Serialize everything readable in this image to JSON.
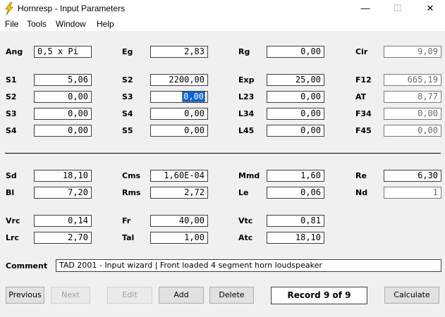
{
  "window": {
    "title": "Hornresp - Input Parameters",
    "min": "—",
    "max": "☐",
    "close": "✕"
  },
  "menu": [
    "File",
    "Tools",
    "Window",
    "Help"
  ],
  "rows": {
    "ang": {
      "label": "Ang",
      "value": "0,5 x Pi"
    },
    "eg": {
      "label": "Eg",
      "value": "2,83"
    },
    "rg": {
      "label": "Rg",
      "value": "0,00"
    },
    "cir": {
      "label": "Cir",
      "value": "9,09"
    },
    "s1": {
      "label": "S1",
      "value": "5,06"
    },
    "s2a": {
      "label": "S2",
      "value": "2200,00"
    },
    "exp": {
      "label": "Exp",
      "value": "25,00"
    },
    "f12": {
      "label": "F12",
      "value": "665,19"
    },
    "s2b": {
      "label": "S2",
      "value": "0,00"
    },
    "s3a": {
      "label": "S3",
      "value": "0,00"
    },
    "l23": {
      "label": "L23",
      "value": "0,00"
    },
    "at": {
      "label": "AT",
      "value": "8,77"
    },
    "s3b": {
      "label": "S3",
      "value": "0,00"
    },
    "s4a": {
      "label": "S4",
      "value": "0,00"
    },
    "l34": {
      "label": "L34",
      "value": "0,00"
    },
    "f34": {
      "label": "F34",
      "value": "0,00"
    },
    "s4b": {
      "label": "S4",
      "value": "0,00"
    },
    "s5": {
      "label": "S5",
      "value": "0,00"
    },
    "l45": {
      "label": "L45",
      "value": "0,00"
    },
    "f45": {
      "label": "F45",
      "value": "0,00"
    },
    "sd": {
      "label": "Sd",
      "value": "18,10"
    },
    "cms": {
      "label": "Cms",
      "value": "1,60E-04"
    },
    "mmd": {
      "label": "Mmd",
      "value": "1,60"
    },
    "re": {
      "label": "Re",
      "value": "6,30"
    },
    "bl": {
      "label": "Bl",
      "value": "7,20"
    },
    "rms": {
      "label": "Rms",
      "value": "2,72"
    },
    "le": {
      "label": "Le",
      "value": "0,06"
    },
    "nd": {
      "label": "Nd",
      "value": "1"
    },
    "vrc": {
      "label": "Vrc",
      "value": "0,14"
    },
    "fr": {
      "label": "Fr",
      "value": "40,00"
    },
    "vtc": {
      "label": "Vtc",
      "value": "0,81"
    },
    "lrc": {
      "label": "Lrc",
      "value": "2,70"
    },
    "tal": {
      "label": "Tal",
      "value": "1,00"
    },
    "atc": {
      "label": "Atc",
      "value": "18,10"
    }
  },
  "comment": {
    "label": "Comment",
    "value": "TAD 2001 - Input wizard | Front loaded 4 segment horn loudspeaker"
  },
  "buttons": {
    "previous": "Previous",
    "next": "Next",
    "edit": "Edit",
    "add": "Add",
    "delete": "Delete",
    "calculate": "Calculate"
  },
  "record": "Record 9 of 9"
}
